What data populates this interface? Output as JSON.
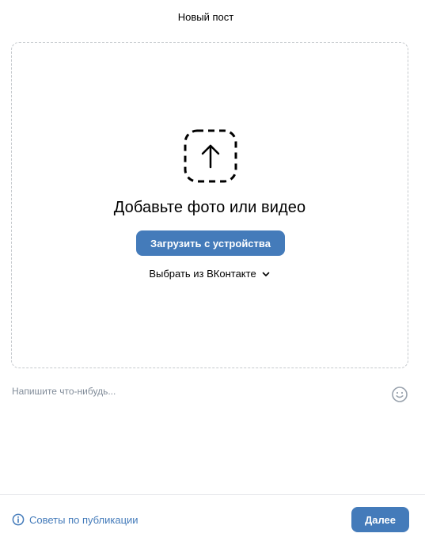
{
  "header": {
    "title": "Новый пост"
  },
  "dropzone": {
    "icon": "upload-arrow-icon",
    "heading": "Добавьте фото или видео",
    "upload_label": "Загрузить с устройства",
    "pick_label": "Выбрать из ВКонтакте",
    "pick_icon": "chevron-down-icon"
  },
  "composer": {
    "placeholder": "Напишите что-нибудь...",
    "value": "",
    "emoji_icon": "smile-icon"
  },
  "footer": {
    "tips_icon": "info-icon",
    "tips_label": "Советы по публикации",
    "next_label": "Далее"
  },
  "colors": {
    "accent": "#447bba",
    "muted_text": "#818c99",
    "border": "#c4c8cc",
    "divider": "#e7e8ec"
  }
}
